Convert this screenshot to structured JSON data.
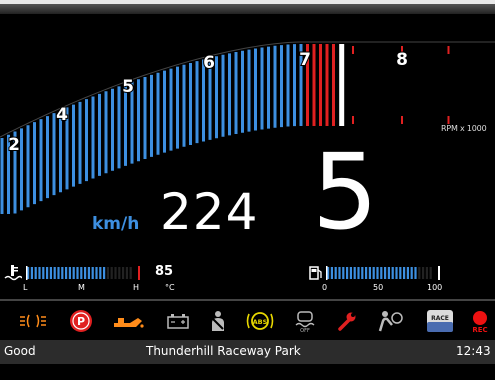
{
  "tachometer": {
    "scale_numbers": [
      "2",
      "4",
      "5",
      "6",
      "7",
      "8"
    ],
    "unit_label": "RPM x 1000",
    "redline_from": 7.0,
    "current_rpm_thousands": 7.4
  },
  "speed": {
    "unit": "km/h",
    "value": "224"
  },
  "gear": {
    "value": "5"
  },
  "coolant_gauge": {
    "icon": "coolant-temperature-icon",
    "scale_labels": [
      "L",
      "M",
      "H"
    ],
    "value": "85",
    "unit": "°C",
    "level": 0.72
  },
  "fuel_gauge": {
    "icon": "fuel-pump-icon",
    "scale_labels": [
      "0",
      "50",
      "100"
    ],
    "level": 0.85
  },
  "warning_icons": [
    {
      "name": "sidelights-icon",
      "color": "#ff8c1a"
    },
    {
      "name": "parking-brake-icon",
      "color": "#e02020"
    },
    {
      "name": "oil-pressure-icon",
      "color": "#ff8c1a"
    },
    {
      "name": "battery-icon",
      "color": "#bbbbbb"
    },
    {
      "name": "seatbelt-icon",
      "color": "#bbbbbb"
    },
    {
      "name": "abs-icon",
      "color": "#e8d800"
    },
    {
      "name": "traction-control-off-icon",
      "color": "#bbbbbb",
      "sub": "OFF"
    },
    {
      "name": "service-wrench-icon",
      "color": "#e02020"
    },
    {
      "name": "airbag-icon",
      "color": "#bbbbbb"
    },
    {
      "name": "race-mode-icon",
      "color": "#cccccc",
      "sub": "RACE"
    },
    {
      "name": "record-icon",
      "color": "#ee1111",
      "sub": "REC"
    }
  ],
  "status_bar": {
    "left": "Good",
    "center": "Thunderhill Raceway Park",
    "right": "12:43"
  },
  "colors": {
    "accent_blue": "#3d8fe0",
    "redline": "#e02020",
    "background": "#000000"
  }
}
